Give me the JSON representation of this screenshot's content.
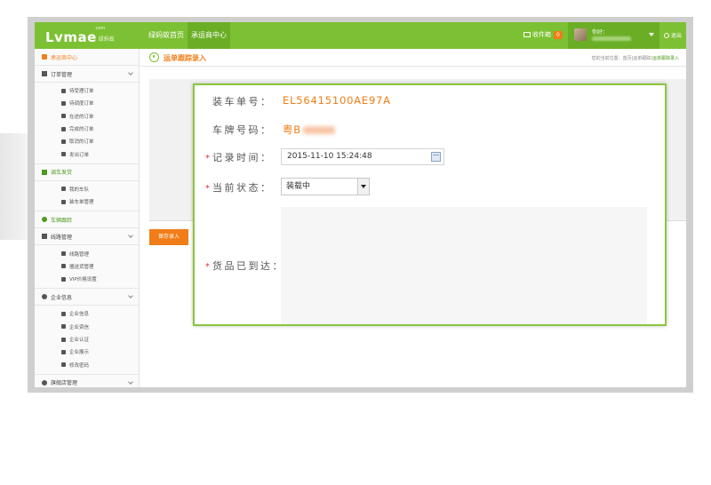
{
  "topbar": {
    "logo_text": "Lvmae",
    "logo_sub": "绿蚂蚁",
    "logo_sup": ".com",
    "nav": [
      "绿蚂蚁首页",
      "承运商中心"
    ],
    "inbox_label": "收件箱",
    "inbox_count": "0",
    "greeting": "你好：",
    "logout_label": "退出",
    "accent_color": "#7cc033"
  },
  "sidebar": {
    "home": "承运商中心",
    "orders": {
      "title": "订单管理",
      "items": [
        "待受理订单",
        "待调度订单",
        "在途的订单",
        "完成的订单",
        "取消的订单",
        "发出订单"
      ]
    },
    "dispatch": {
      "title": "调车发货",
      "items": [
        "我的车队",
        "装车单管理"
      ]
    },
    "tracking": "车辆跟踪",
    "routes": {
      "title": "线路管理",
      "items": [
        "线路管理",
        "擅送货管理",
        "VIP价格设置"
      ]
    },
    "company": {
      "title": "企业信息",
      "items": [
        "企业信息",
        "企业资信",
        "企业认证",
        "企业展示",
        "修改密码"
      ]
    },
    "flagship": "旗舰店管理"
  },
  "content": {
    "page_title": "运单跟踪录入",
    "crumb_prefix": "您的当前位置：首页|运单跟踪|",
    "crumb_current": "运单跟踪录入",
    "save_label": "保存录入"
  },
  "modal": {
    "loading_no_label": "装车单号：",
    "loading_no_value": "EL56415100AE97A",
    "plate_label": "车牌号码：",
    "plate_value": "粤B",
    "record_time_label": "记录时间：",
    "record_time_value": "2015-11-10 15:24:48",
    "status_label": "当前状态：",
    "status_value": "装载中",
    "arrived_label": "货品已到达：",
    "required_mark": "*"
  }
}
